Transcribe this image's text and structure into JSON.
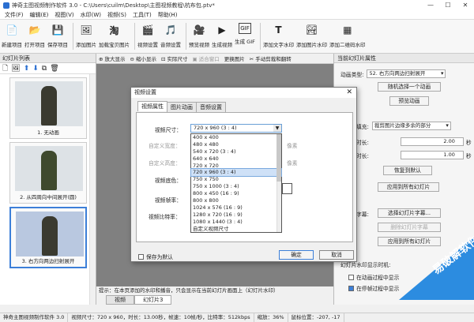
{
  "window": {
    "title": "神奇主图视频制作软件 3.0 - C:\\Users\\cuilm\\Desktop\\主图视频教程\\杭布包.ptv*",
    "min": "—",
    "max": "☐",
    "close": "✕"
  },
  "menu": [
    "文件(F)",
    "编辑(E)",
    "视图(V)",
    "水印(W)",
    "帮助(H)"
  ],
  "menu_extra": [
    "视频(S)",
    "工具(T)"
  ],
  "toolbar": [
    {
      "label": "新建项目",
      "icon": "new-project-icon",
      "glyph": "📄"
    },
    {
      "label": "打开项目",
      "icon": "open-project-icon",
      "glyph": "📂"
    },
    {
      "label": "保存项目",
      "icon": "save-project-icon",
      "glyph": "💾"
    },
    {
      "label": "添加图片",
      "icon": "add-image-icon",
      "glyph": "🖼"
    },
    {
      "label": "加载宝贝图片",
      "icon": "taobao-icon",
      "glyph": "淘"
    },
    {
      "label": "视频设置",
      "icon": "video-settings-icon",
      "glyph": "🎬"
    },
    {
      "label": "音频设置",
      "icon": "audio-settings-icon",
      "glyph": "🎵"
    },
    {
      "label": "预览视频",
      "icon": "preview-video-icon",
      "glyph": "🎥"
    },
    {
      "label": "生成视频",
      "icon": "generate-video-icon",
      "glyph": "▶"
    },
    {
      "label": "生成 GIF",
      "icon": "gif-icon",
      "glyph": "GIF"
    },
    {
      "label": "添加文字水印",
      "icon": "text-watermark-icon",
      "glyph": "T"
    },
    {
      "label": "添加图片水印",
      "icon": "image-watermark-icon",
      "glyph": "🏞"
    },
    {
      "label": "添加二维码水印",
      "icon": "qrcode-icon",
      "glyph": "▦"
    }
  ],
  "left_panel": {
    "title": "幻灯片列表",
    "slides": [
      {
        "caption": "1. 无动画",
        "selected": false
      },
      {
        "caption": "2. 从四周向中间展开(圆)",
        "selected": false
      },
      {
        "caption": "3. 右方向两边扫射展开",
        "selected": true
      }
    ]
  },
  "center_toolbar": [
    "放大显示",
    "缩小显示",
    "实际尺寸",
    "适合窗口",
    "更换图片",
    "手动剪裁和翻转"
  ],
  "tip": "提示：在本页添加的水印和播音，只会显示在当前幻灯片画面上（幻灯片水印）",
  "bottom_tabs": [
    "视频",
    "幻灯片3"
  ],
  "right_panel": {
    "title": "当前幻灯片属性",
    "anim_label": "动画类型:",
    "anim_value": "52. 右方向两边扫射展开",
    "btn_random": "随机选择一个动画",
    "btn_preview": "预览动画",
    "fill_label": "填充:",
    "fill_value": "裁剪图片边缘多余的部分",
    "dur1_label": "时长:",
    "dur1_value": "2.00",
    "dur2_label": "时长:",
    "dur2_value": "1.00",
    "unit": "秒",
    "btn_restore": "恢复到默认",
    "btn_apply_all": "应用到所有幻灯片",
    "subtitle_label": "字幕:",
    "btn_choose_sub": "选择幻灯片字幕...",
    "btn_remove_sub": "删除幻灯片字幕",
    "btn_apply_all2": "应用到所有幻灯片",
    "wm_group": "幻灯片水印显示时机:",
    "wm_opt1": "在动画过程中显示",
    "wm_opt2": "在停帧过程中显示"
  },
  "brand_watermark": "易破解软件",
  "status": [
    "神奇主图视频制作软件 3.0",
    "视频尺寸：720 x 960，时长：13.00秒，帧速：10帧/秒，比特率：512kbps",
    "缩放：36%",
    "鼠标位置：-207, -17"
  ],
  "dialog": {
    "title": "视频设置",
    "close": "✕",
    "tabs": [
      "视频属性",
      "图片动画",
      "音频设置"
    ],
    "size_label": "视频尺寸：",
    "size_value": "720 x 960  (3 : 4)",
    "custom_w": "自定义宽度：",
    "custom_h": "自定义高度：",
    "bg_label": "视频底色：",
    "fps_label": "视频帧率：",
    "bitrate_label": "视频比特率：",
    "px": "像素",
    "options": [
      "400 x 400",
      "480 x 480",
      "540 x 720  (3 : 4)",
      "640 x 640",
      "720 x 720",
      "720 x 960  (3 : 4)",
      "750 x 750",
      "750 x 1000  (3 : 4)",
      "800 x 450  (16 : 9)",
      "800 x 800",
      "1024 x 576  (16 : 9)",
      "1280 x 720  (16 : 9)",
      "1080 x 1440  (3 : 4)",
      "自定义视频尺寸"
    ],
    "selected_index": 5,
    "save_default": "保存为默认",
    "ok": "确定",
    "cancel": "取消"
  },
  "colors": {
    "accent": "#3c7fd8",
    "canvas": "#808080",
    "watermark": "#2c8ce0"
  }
}
